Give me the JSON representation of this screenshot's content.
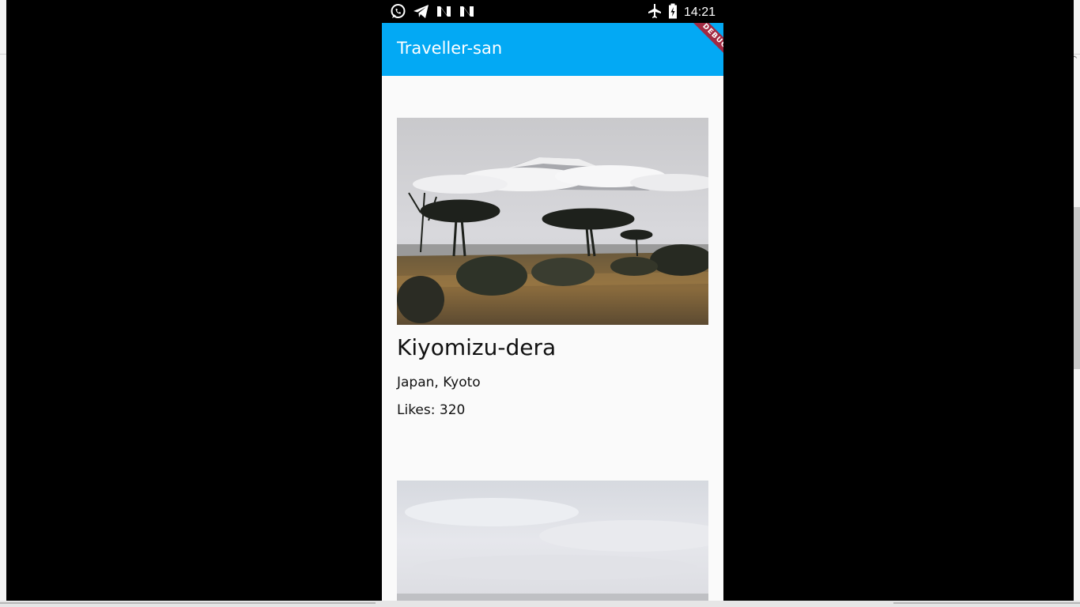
{
  "status_bar": {
    "time": "14:21",
    "left_icons": [
      "whatsapp-icon",
      "telegram-icon",
      "n-notification-icon",
      "n-notification-icon"
    ],
    "right_icons": [
      "airplane-mode-icon",
      "battery-charging-icon"
    ]
  },
  "app_bar": {
    "title": "Traveller-san",
    "color": "#03a9f4"
  },
  "debug_banner": {
    "label": "DEBUG",
    "color": "#a22a42"
  },
  "places": [
    {
      "name": "Kiyomizu-dera",
      "location": "Japan, Kyoto",
      "likes": "Likes: 320"
    }
  ]
}
